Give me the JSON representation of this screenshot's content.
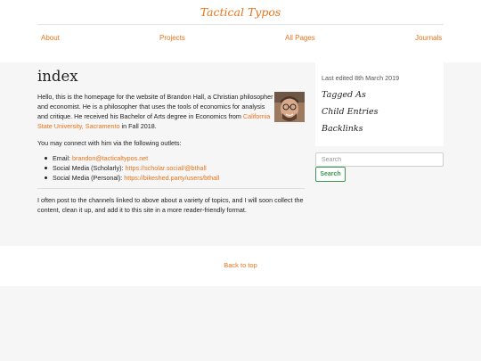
{
  "header": {
    "site_title": "Tactical Typos",
    "nav": {
      "about": "About",
      "projects": "Projects",
      "all_pages": "All Pages",
      "journals": "Journals"
    }
  },
  "main": {
    "title": "index",
    "intro": {
      "text_before_link": "Hello, this is the homepage for the website of Brandon Hall, a Christian philosopher and economist. He is a philosopher that uses the tools of economics for analysis and critique. He received his Bachelor of Arts degree in Economics from ",
      "link": "California State University, Sacramento",
      "text_after_link": " in Fall 2018."
    },
    "connect": "You may connect with him via the following outlets:",
    "contacts": [
      {
        "label": "Email: ",
        "value": "brandon@tacticaltypos.net"
      },
      {
        "label": "Social Media (Scholarly): ",
        "value": "https://scholar.social/@bthall"
      },
      {
        "label": "Social Media (Personal): ",
        "value": "https://bikeshed.party/users/bthall"
      }
    ],
    "outro": "I often post to the channels linked to above about a variety of topics, and I will soon collect the content, clean it up, and add it to this site in a more reader-friendly format."
  },
  "sidebar": {
    "last_edited": "Last edited 8th March 2019",
    "tagged_as": "Tagged As",
    "child_entries": "Child Entries",
    "backlinks": "Backlinks",
    "search_placeholder": "Search",
    "search_button": "Search"
  },
  "footer": {
    "back_to_top": "Back to top"
  },
  "colors": {
    "accent": "#e8741c",
    "search_button": "#3a9a54",
    "background": "#f6f6f6"
  }
}
